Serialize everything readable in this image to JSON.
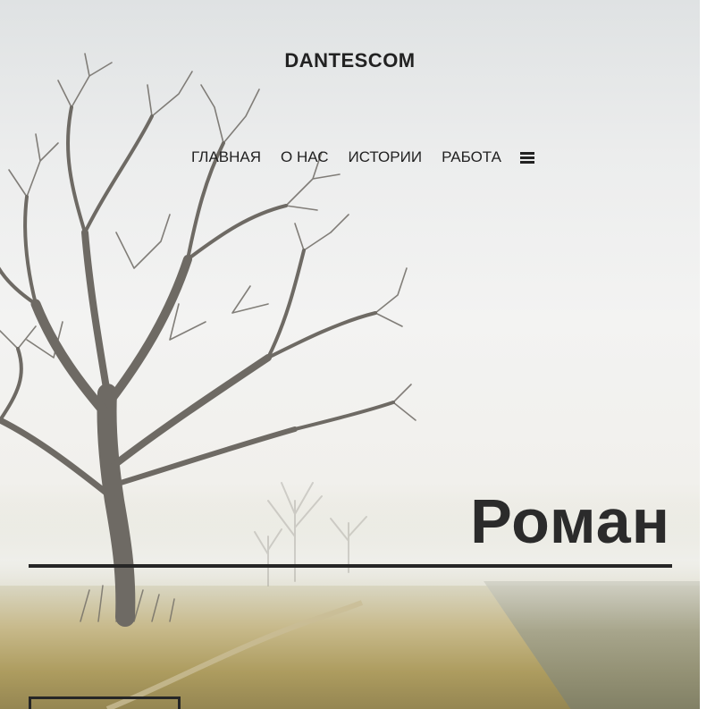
{
  "site": {
    "logo": "DANTESCOM"
  },
  "nav": {
    "items": [
      {
        "label": "ГЛАВНАЯ"
      },
      {
        "label": "О НАС"
      },
      {
        "label": "ИСТОРИИ"
      },
      {
        "label": "РАБОТА"
      }
    ],
    "menu_icon": "hamburger-menu-icon"
  },
  "hero": {
    "title": "Роман",
    "background": "foggy-field-with-tree",
    "button_label": ""
  },
  "colors": {
    "text": "#222222",
    "rule": "#262626",
    "sky": "#eceded",
    "field": "#ad9c5f"
  }
}
